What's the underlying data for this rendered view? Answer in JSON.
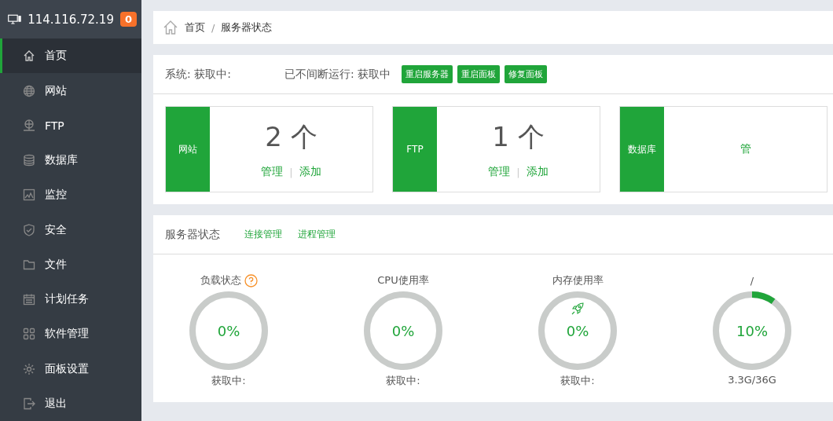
{
  "sidebar": {
    "host": "114.116.72.19",
    "badge": "0",
    "items": [
      {
        "label": "首页",
        "selected": true
      },
      {
        "label": "网站",
        "selected": false
      },
      {
        "label": "FTP",
        "selected": false
      },
      {
        "label": "数据库",
        "selected": false
      },
      {
        "label": "监控",
        "selected": false
      },
      {
        "label": "安全",
        "selected": false
      },
      {
        "label": "文件",
        "selected": false
      },
      {
        "label": "计划任务",
        "selected": false
      },
      {
        "label": "软件管理",
        "selected": false
      },
      {
        "label": "面板设置",
        "selected": false
      },
      {
        "label": "退出",
        "selected": false
      }
    ]
  },
  "breadcrumb": {
    "items": [
      "首页",
      "服务器状态"
    ],
    "separator": "/"
  },
  "system_bar": {
    "system": "系统: 获取中:",
    "uptime": "已不间断运行: 获取中",
    "buttons": [
      "重启服务器",
      "重启面板",
      "修复面板"
    ]
  },
  "summary_cards": [
    {
      "label": "网站",
      "count": "2 个",
      "links": [
        "管理",
        "添加"
      ],
      "separator": "|"
    },
    {
      "label": "FTP",
      "count": "1 个",
      "links": [
        "管理",
        "添加"
      ],
      "separator": "|"
    },
    {
      "label": "数据库",
      "links": [
        "管"
      ]
    }
  ],
  "server_status": {
    "title": "服务器状态",
    "links": [
      "连接管理",
      "进程管理"
    ],
    "gauges": [
      {
        "title": "负载状态",
        "kind": "help",
        "value": "0%",
        "caption": "获取中:"
      },
      {
        "title": "CPU使用率",
        "kind": "plain",
        "value": "0%",
        "caption": "获取中:"
      },
      {
        "title": "内存使用率",
        "kind": "rocket",
        "value": "0%",
        "caption": "获取中:"
      },
      {
        "title": "/",
        "kind": "plain",
        "value": "10%",
        "caption": "3.3G/36G"
      }
    ]
  }
}
